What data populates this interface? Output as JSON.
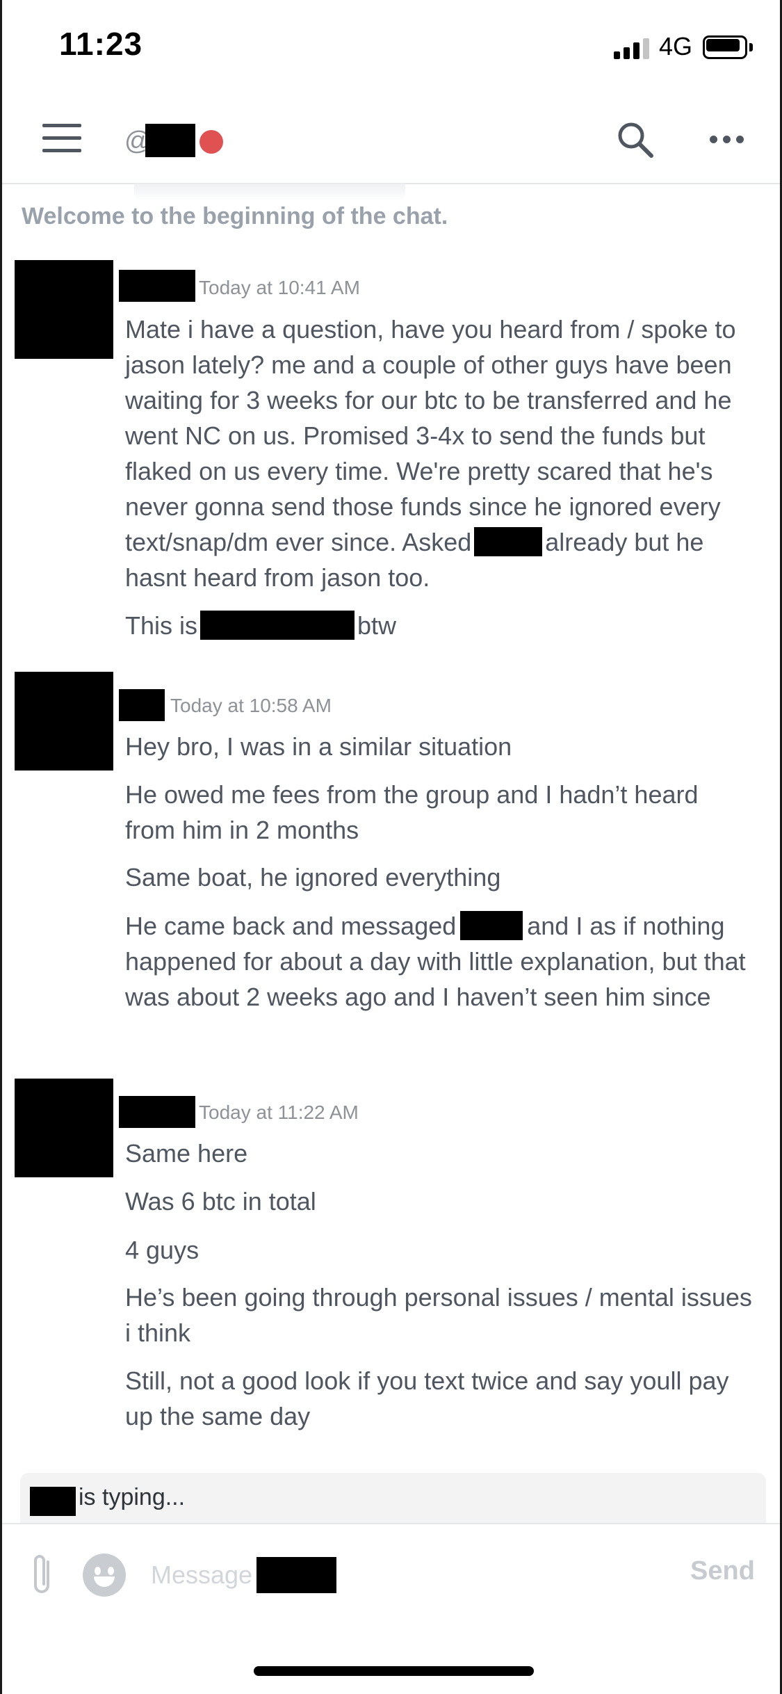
{
  "status_bar": {
    "time": "11:23",
    "network": "4G",
    "icons": [
      "signal-icon",
      "battery-icon"
    ]
  },
  "header": {
    "at_symbol": "@",
    "presence_color": "#e05252",
    "icons": [
      "menu-icon",
      "search-icon",
      "more-icon"
    ]
  },
  "welcome_text": "Welcome to the beginning of the chat.",
  "messages": [
    {
      "timestamp": "Today at 10:41 AM",
      "lines": [
        {
          "text_a": "Mate i have a question, have you heard from / spoke to jason lately? me and a couple of other guys have been waiting for 3 weeks for our btc to be transferred and he went NC on us. Promised 3-4x to send the funds but flaked on us every time. We're pretty scared that he's never gonna send those funds since he ignored every text/snap/dm ever since. Asked",
          "text_b": "already but he hasnt heard from jason too."
        },
        {
          "text_a": "This is",
          "text_b": "btw"
        }
      ]
    },
    {
      "timestamp": "Today at 10:58 AM",
      "lines": [
        {
          "text": "Hey bro, I was in a similar situation"
        },
        {
          "text": "He owed me fees from the group and I hadn’t heard from him in 2 months"
        },
        {
          "text": "Same boat, he ignored everything"
        },
        {
          "text_a": "He came back and messaged",
          "text_b": "and I as if nothing happened for about a day with little explanation, but that was about 2 weeks ago and I haven’t seen him since"
        }
      ]
    },
    {
      "timestamp": "Today at 11:22 AM",
      "lines": [
        {
          "text": "Same here"
        },
        {
          "text": "Was 6 btc in total"
        },
        {
          "text": "4 guys"
        },
        {
          "text": "He’s been going through personal issues / mental issues i think"
        },
        {
          "text": "Still, not a good look if you text twice and say youll pay up the same day"
        }
      ]
    }
  ],
  "typing_indicator": {
    "text": "is typing..."
  },
  "composer": {
    "placeholder": "Message",
    "value": "",
    "send_label": "Send",
    "icons": [
      "attach-icon",
      "emoji-icon"
    ]
  }
}
